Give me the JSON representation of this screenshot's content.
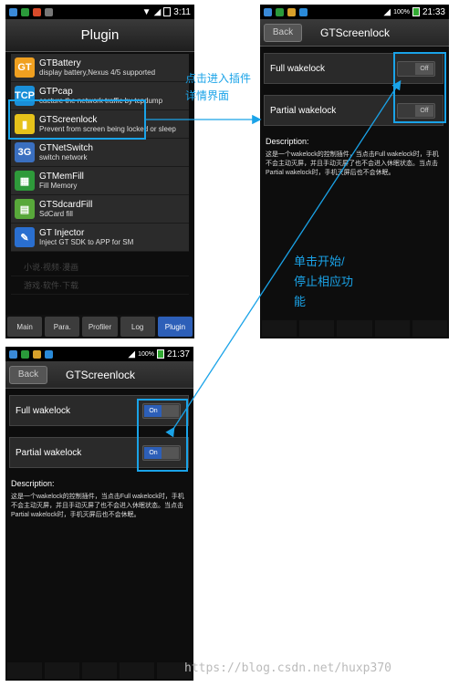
{
  "phone1": {
    "status_time": "3:11",
    "title": "Plugin",
    "plugins": [
      {
        "name": "GTBattery",
        "desc": "display battery,Nexus 4/5 supported",
        "icon": "battery-icon",
        "icon_color": "#f0a020",
        "glyph": "GT"
      },
      {
        "name": "GTPcap",
        "desc": "cacture the network traffic by tcpdump",
        "icon": "network-capture-icon",
        "icon_color": "#1a8fd8",
        "glyph": "TCP"
      },
      {
        "name": "GTScreenlock",
        "desc": "Prevent from screen being locked or sleep",
        "icon": "phone-lock-icon",
        "icon_color": "#e6c21a",
        "glyph": "▮"
      },
      {
        "name": "GTNetSwitch",
        "desc": "switch network",
        "icon": "net-switch-icon",
        "icon_color": "#3a6fc0",
        "glyph": "3G"
      },
      {
        "name": "GTMemFill",
        "desc": "Fill Memory",
        "icon": "memory-chip-icon",
        "icon_color": "#2e9a3a",
        "glyph": "▦"
      },
      {
        "name": "GTSdcardFill",
        "desc": "SdCard fill",
        "icon": "sdcard-icon",
        "icon_color": "#58a83a",
        "glyph": "▤"
      },
      {
        "name": "GT Injector",
        "desc": "Inject GT SDK to APP for SM",
        "icon": "syringe-icon",
        "icon_color": "#2a6fd0",
        "glyph": "✎"
      }
    ],
    "faded_rows": [
      "小说·视频·漫画",
      "游戏·软件·下载"
    ],
    "tabs": [
      "Main",
      "Para.",
      "Profiler",
      "Log",
      "Plugin"
    ],
    "active_tab": "Plugin"
  },
  "phone2": {
    "status_time": "21:33",
    "battery": "100%",
    "back_label": "Back",
    "title": "GTScreenlock",
    "full_wakelock_label": "Full wakelock",
    "partial_wakelock_label": "Partial wakelock",
    "full_state": "Off",
    "partial_state": "Off",
    "description_label": "Description:",
    "description_text": "这是一个wakelock的控制插件，当点击Full wakelock时，手机不会主动灭屏，并且手动灭屏了也不会进入休眠状态。当点击Partial wakelock时，手机灭屏后也不会休眠。"
  },
  "phone3": {
    "status_time": "21:37",
    "battery": "100%",
    "back_label": "Back",
    "title": "GTScreenlock",
    "full_wakelock_label": "Full wakelock",
    "partial_wakelock_label": "Partial wakelock",
    "full_state": "On",
    "partial_state": "On",
    "description_label": "Description:",
    "description_text": "这是一个wakelock的控制插件，当点击Full wakelock时，手机不会主动灭屏，并且手动灭屏了也不会进入休眠状态。当点击Partial wakelock时，手机灭屏后也不会休眠。"
  },
  "annotations": {
    "enter_detail_line1": "点击进入插件",
    "enter_detail_line2": "详情界面",
    "toggle_line1": "单击开始/",
    "toggle_line2": "停止相应功",
    "toggle_line3": "能"
  },
  "watermark": "https://blog.csdn.net/huxp370",
  "colors": {
    "highlight": "#1aa3e8",
    "active_tab": "#2d5fb8"
  }
}
